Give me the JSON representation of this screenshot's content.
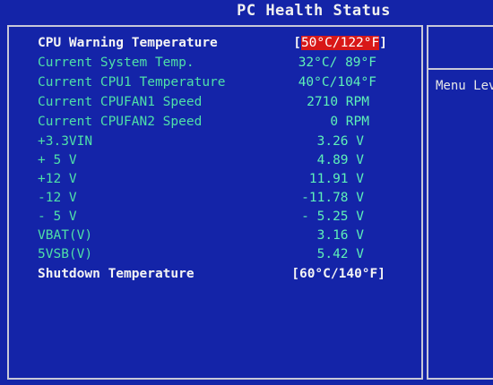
{
  "header": {
    "title": "PC Health Status"
  },
  "help": {
    "text": "Menu Lev"
  },
  "rows": [
    {
      "label": "CPU Warning Temperature",
      "value": "50°C/122°F",
      "open": "[",
      "close": "]"
    },
    {
      "label": "Current System Temp.",
      "value": "32°C/ 89°F"
    },
    {
      "label": "Current CPU1 Temperature",
      "value": "40°C/104°F"
    },
    {
      "label": "Current CPUFAN1 Speed",
      "value": "2710 RPM"
    },
    {
      "label": "Current CPUFAN2 Speed",
      "value": "0 RPM"
    },
    {
      "label": "+3.3VIN",
      "value": "3.26 V"
    },
    {
      "label": "+ 5 V",
      "value": "4.89 V"
    },
    {
      "label": "+12 V",
      "value": "11.91 V"
    },
    {
      "label": "-12 V",
      "value": "-11.78 V"
    },
    {
      "label": "- 5 V",
      "value": "- 5.25 V"
    },
    {
      "label": "VBAT(V)",
      "value": "3.16 V"
    },
    {
      "label": "5VSB(V)",
      "value": "5.42 V"
    },
    {
      "label": "Shutdown Temperature",
      "value": "[60°C/140°F]"
    }
  ],
  "colors": {
    "background": "#1424a8",
    "label_green": "#4fe0a8",
    "label_white": "#f4f4f4",
    "highlight": "#d81818",
    "border": "#c8c8d8"
  }
}
